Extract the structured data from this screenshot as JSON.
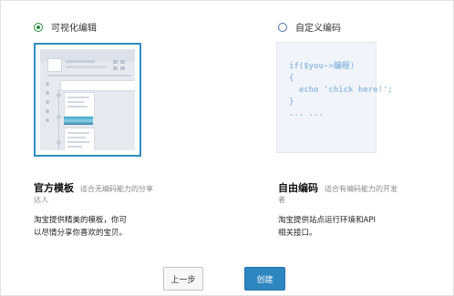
{
  "options": {
    "visual": {
      "radio_label": "可视化编辑",
      "title": "官方模板",
      "subtitle_line1": "适合无编码能力的分享",
      "subtitle_line2": "达人",
      "desc_line1": "淘宝提供精美的模板，你可",
      "desc_line2": "以尽情分享你喜欢的宝贝。",
      "selected": true
    },
    "custom": {
      "radio_label": "自定义编码",
      "title": "自由编码",
      "subtitle_line1": "适合有编码能力的开发",
      "subtitle_line2": "者",
      "desc_line1": "淘宝提供站点运行环境和API",
      "desc_line2": "相关接口。",
      "selected": false,
      "code_sample": "if($you->编程)\n{\n  echo 'chick here!';\n}\n... ..."
    }
  },
  "buttons": {
    "prev_label": "上一步",
    "create_label": "创建"
  },
  "colors": {
    "accent": "#2e86c1",
    "radio_selected": "#2a8a3e",
    "code": "#9bbfe3"
  }
}
